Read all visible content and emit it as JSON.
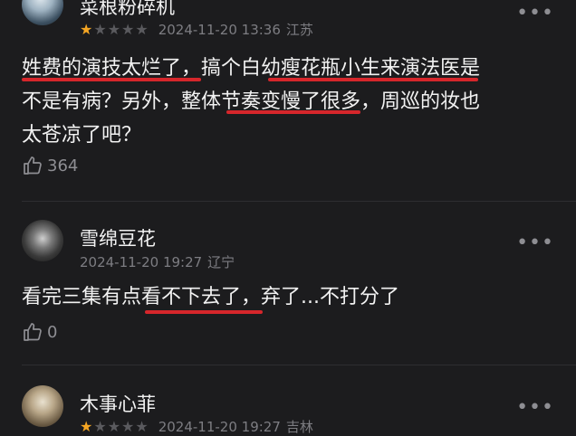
{
  "comments": [
    {
      "username": "菜根粉碎机",
      "timestamp": "2024-11-20 13:36",
      "location": "江苏",
      "rating": 1,
      "lines": [
        "姓费的演技太烂了，搞个白幼瘦花瓶小生来演法医是",
        "不是有病？另外，整体节奏变慢了很多，周巡的妆也",
        "太苍凉了吧？"
      ],
      "likes": "364",
      "more": "•••"
    },
    {
      "username": "雪绵豆花",
      "timestamp": "2024-11-20 19:27",
      "location": "辽宁",
      "lines": [
        "看完三集有点看不下去了，弃了...不打分了"
      ],
      "likes": "0",
      "more": "•••"
    },
    {
      "username": "木事心菲",
      "timestamp": "2024-11-20 19:27",
      "location": "吉林",
      "rating": 1,
      "more": "•••"
    }
  ],
  "colors": {
    "background": "#1c1c1e",
    "underline": "#d6262b",
    "star": "#f5a623"
  },
  "icons": {
    "like": "thumbs-up-icon",
    "more": "more-dots-icon",
    "star": "star-icon"
  }
}
